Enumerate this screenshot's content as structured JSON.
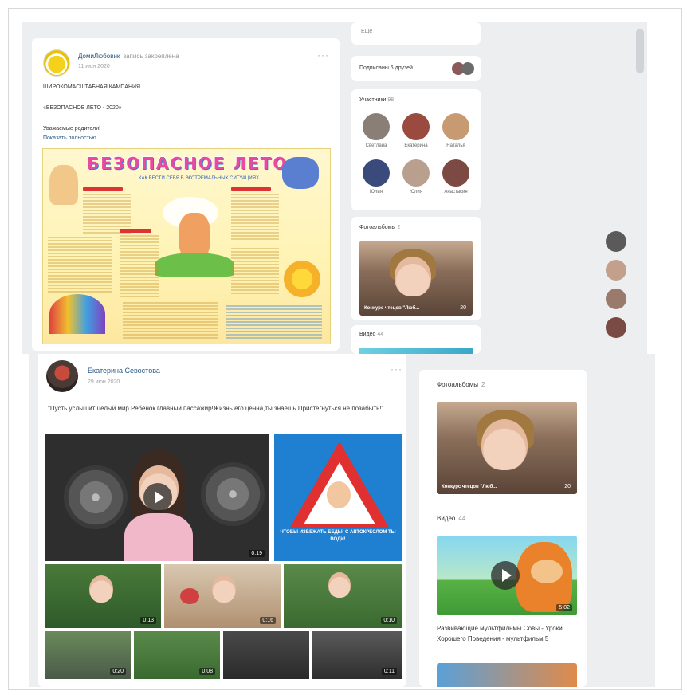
{
  "top_post": {
    "author": "ДомиЛюбовик",
    "author_action": "запись закреплена",
    "date": "11 июн 2020",
    "line1": "ШИРОКОМАСШТАБНАЯ КАМПАНИЯ",
    "line2": "«БЕЗОПАСНОЕ ЛЕТО - 2020»",
    "line3": "Уважаемые родители!",
    "show_more": "Показать полностью...",
    "poster_title": "БЕЗОПАСНОЕ ЛЕТО",
    "poster_subtitle": "КАК ВЕСТИ СЕБЯ В ЭКСТРЕМАЛЬНЫХ СИТУАЦИЯХ",
    "more_icon": "more-horizontal-icon"
  },
  "sidebar_top": {
    "search_label": "Ещё",
    "friends_subscribed": "Подписаны 6 друзей",
    "members_label": "Участники",
    "members_count": "98",
    "members": [
      {
        "name": "Светлана",
        "color": "#8a7f76"
      },
      {
        "name": "Екатерина",
        "color": "#9a4a3e"
      },
      {
        "name": "Наталья",
        "color": "#c89a72"
      },
      {
        "name": "Юлия",
        "color": "#3a4a7a"
      },
      {
        "name": "Юлия",
        "color": "#b9a08e"
      },
      {
        "name": "Анастасия",
        "color": "#7c4a42"
      }
    ],
    "albums_label": "Фотоальбомы",
    "albums_count": "2",
    "album_caption": "Конкурс чтецов \"Люб...",
    "album_count_badge": "20",
    "video_label": "Видео",
    "video_count": "44"
  },
  "bottom_post": {
    "author": "Екатерина Севостова",
    "date": "29 июн 2020",
    "text": "\"Пусть услышит целый мир.Ребёнок главный пассажир!Жизнь его ценна,ты знаешь.Пристегнуться не позабыть!\"",
    "main_video_duration": "0:19",
    "banner_text": "ЧТОБЫ ИЗБЕЖАТЬ БЕДЫ, С АВТОКРЕСЛОМ ТЫ ВОДИ!",
    "row2_durations": [
      "0:13",
      "0:16",
      "0:10"
    ],
    "row3_durations": [
      "0:20",
      "0:08",
      "",
      "0:11"
    ],
    "more_icon": "more-horizontal-icon"
  },
  "sidebar_bottom": {
    "albums_label": "Фотоальбомы",
    "albums_count": "2",
    "album_caption": "Конкурс чтецов \"Люб...",
    "album_count_badge": "20",
    "video_label": "Видео",
    "video_count": "44",
    "video_duration": "5:02",
    "video_caption": "Развивающие мультфильмы Совы - Уроки Хорошего Поведения - мультфильм 5"
  },
  "colors": {
    "page_bg": "#edeef0",
    "link": "#2a5885",
    "muted": "#939393"
  }
}
